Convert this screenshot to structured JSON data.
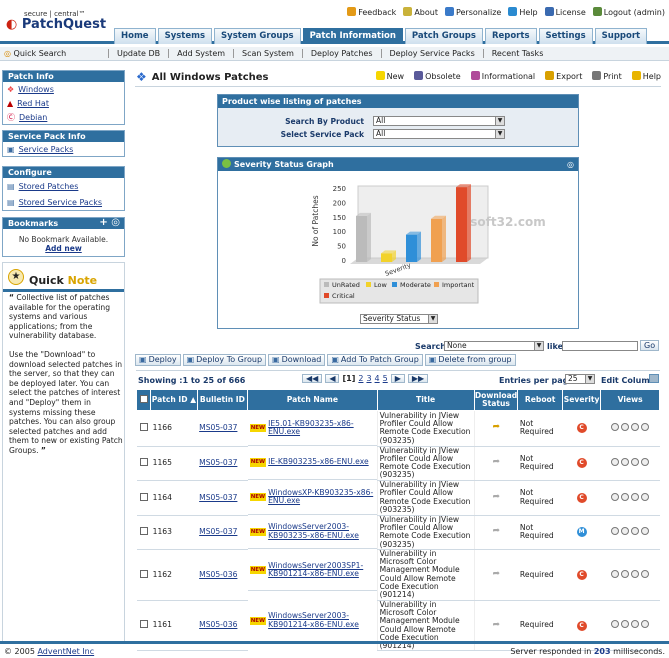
{
  "header": {
    "logo_small": "secure | central™",
    "logo_main": "PatchQuest",
    "toplinks": [
      {
        "label": "Feedback",
        "icon": "feedback-icon",
        "color": "#e39a17"
      },
      {
        "label": "About",
        "icon": "about-icon",
        "color": "#c9b23a"
      },
      {
        "label": "Personalize",
        "icon": "personalize-icon",
        "color": "#3a7ac9"
      },
      {
        "label": "Help",
        "icon": "help-icon",
        "color": "#2a8ad0"
      },
      {
        "label": "License",
        "icon": "license-icon",
        "color": "#3a6ab0"
      },
      {
        "label": "Logout (admin)",
        "icon": "logout-icon",
        "color": "#5a8a3a"
      }
    ],
    "tabs": [
      "Home",
      "Systems",
      "System Groups",
      "Patch Information",
      "Patch Groups",
      "Reports",
      "Settings",
      "Support"
    ],
    "active_tab": "Patch Information"
  },
  "subnav": {
    "quick_search": "Quick Search",
    "items": [
      "Update DB",
      "Add System",
      "Scan System",
      "Deploy Patches",
      "Deploy Service Packs",
      "Recent Tasks"
    ]
  },
  "sidebar": {
    "patch_info": {
      "title": "Patch Info",
      "items": [
        "Windows",
        "Red Hat",
        "Debian"
      ]
    },
    "service_pack": {
      "title": "Service Pack Info",
      "items": [
        "Service Packs"
      ]
    },
    "configure": {
      "title": "Configure",
      "items": [
        "Stored Patches",
        "Stored Service Packs"
      ]
    },
    "bookmarks": {
      "title": "Bookmarks",
      "empty": "No Bookmark Available.",
      "add": "Add new"
    },
    "quick_note": {
      "title_a": "Quick ",
      "title_b": "Note",
      "para1": "Collective list of patches available for the operating systems and various applications; from the vulnerability database.",
      "para2": "Use the \"Download\" to download selected patches in the server, so that they can be deployed later. You can select the patches of interest and \"Deploy\" them in systems missing these patches. You can also group selected patches and add them to new or existing Patch Groups."
    }
  },
  "main": {
    "title": "All Windows Patches",
    "actions": [
      "New",
      "Obsolete",
      "Informational",
      "Export",
      "Print",
      "Help"
    ],
    "filter": {
      "title": "Product wise listing of patches",
      "product_label": "Search By Product",
      "product_value": "All",
      "sp_label": "Select Service Pack",
      "sp_value": "All"
    },
    "graph": {
      "title": "Severity Status Graph",
      "selector": "Severity Status"
    },
    "search": {
      "label": "Search",
      "field": "None",
      "like": "like",
      "go": "Go"
    },
    "toolbar": [
      "Deploy",
      "Deploy To Group",
      "Download",
      "Add To Patch Group",
      "Delete from group"
    ],
    "paging": {
      "showing": "Showing :1 to 25 of 666",
      "pages": [
        "[1]",
        "2",
        "3",
        "4",
        "5"
      ],
      "per_page_label": "Entries per page",
      "per_page": "25",
      "edit_col": "Edit Column"
    },
    "columns": [
      "Patch ID",
      "Bulletin ID",
      "Patch Name",
      "Title",
      "Download Status",
      "Reboot",
      "Severity",
      "Views"
    ],
    "rows": [
      {
        "id": "1166",
        "bulletin": "MS05-037",
        "name": "IE5.01-KB903235-x86-ENU.exe",
        "title": "Vulnerability in JView Profiler Could Allow Remote Code Execution (903235)",
        "reboot": "Not Required",
        "sev": "C",
        "downloaded": true
      },
      {
        "id": "1165",
        "bulletin": "MS05-037",
        "name": "IE-KB903235-x86-ENU.exe",
        "title": "Vulnerability in JView Profiler Could Allow Remote Code Execution (903235)",
        "reboot": "Not Required",
        "sev": "C",
        "downloaded": false
      },
      {
        "id": "1164",
        "bulletin": "MS05-037",
        "name": "WindowsXP-KB903235-x86-ENU.exe",
        "title": "Vulnerability in JView Profiler Could Allow Remote Code Execution (903235)",
        "reboot": "Not Required",
        "sev": "C",
        "downloaded": false
      },
      {
        "id": "1163",
        "bulletin": "MS05-037",
        "name": "WindowsServer2003-KB903235-x86-ENU.exe",
        "title": "Vulnerability in JView Profiler Could Allow Remote Code Execution (903235)",
        "reboot": "Not Required",
        "sev": "M",
        "downloaded": false
      },
      {
        "id": "1162",
        "bulletin": "MS05-036",
        "name": "WindowsServer2003SP1-KB901214-x86-ENU.exe",
        "title": "Vulnerability in Microsoft Color Management Module Could Allow Remote Code Execution (901214)",
        "reboot": "Required",
        "sev": "C",
        "downloaded": false
      },
      {
        "id": "1161",
        "bulletin": "MS05-036",
        "name": "WindowsServer2003-KB901214-x86-ENU.exe",
        "title": "Vulnerability in Microsoft Color Management Module Could Allow Remote Code Execution (901214)",
        "reboot": "Required",
        "sev": "C",
        "downloaded": false
      }
    ]
  },
  "chart_data": {
    "type": "bar",
    "categories": [
      "UnRated",
      "Low",
      "Moderate",
      "Important",
      "Critical"
    ],
    "values": [
      160,
      30,
      95,
      150,
      260
    ],
    "colors": [
      "#bbbbbb",
      "#f2d22a",
      "#2f8fd8",
      "#f0a050",
      "#e04a2a"
    ],
    "xlabel": "Severity",
    "ylabel": "No of Patches",
    "ylim": [
      0,
      250
    ],
    "ticks": [
      "0",
      "50",
      "100",
      "150",
      "200",
      "250"
    ]
  },
  "watermark": "soft32.com",
  "footer": {
    "copyright": "© 2005",
    "company": "AdventNet Inc",
    "server_a": "Server responded in",
    "server_ms": "203",
    "server_b": "milliseconds."
  }
}
